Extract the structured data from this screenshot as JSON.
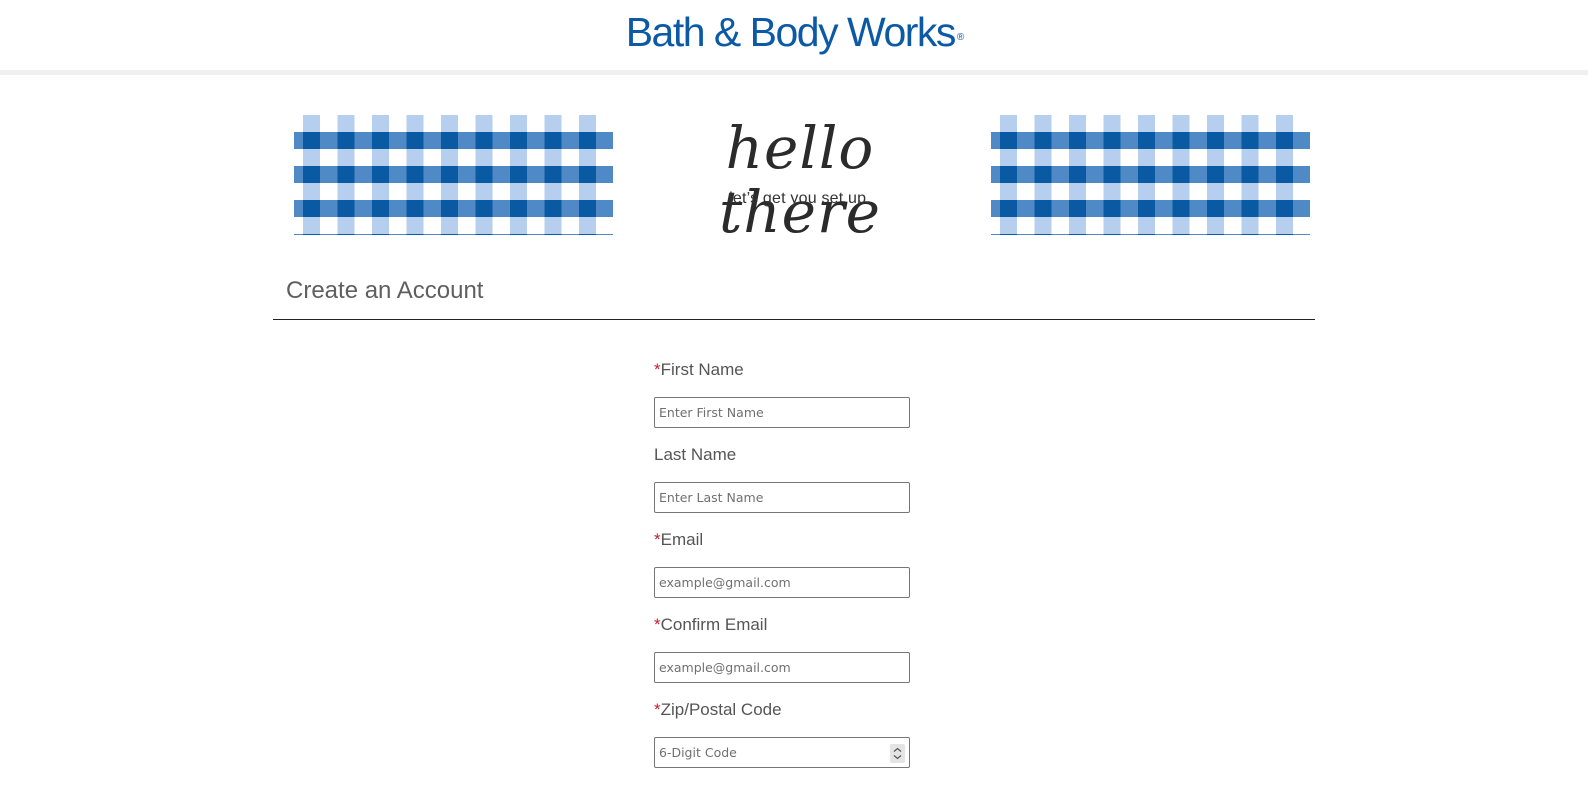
{
  "header": {
    "brand": "Bath & Body Works",
    "registered_mark": "®"
  },
  "banner": {
    "headline": "hello there",
    "subline": "let’s get you set up.",
    "colors": {
      "dark": "#0a5aa3",
      "medium": "#4f8ac6",
      "light": "#b7cfee",
      "white": "#ffffff"
    }
  },
  "section": {
    "title": "Create an Account"
  },
  "form": {
    "required_marker": "*",
    "fields": [
      {
        "label": "First Name",
        "required": true,
        "placeholder": "Enter First Name",
        "value": ""
      },
      {
        "label": "Last Name",
        "required": false,
        "placeholder": "Enter Last Name",
        "value": ""
      },
      {
        "label": "Email",
        "required": true,
        "placeholder": "example@gmail.com",
        "value": ""
      },
      {
        "label": "Confirm Email",
        "required": true,
        "placeholder": "example@gmail.com",
        "value": ""
      },
      {
        "label": "Zip/Postal Code",
        "required": true,
        "placeholder": "6-Digit Code",
        "value": ""
      }
    ]
  },
  "colors": {
    "brand_blue": "#0c5aa6",
    "required_red": "#c21f32",
    "label_gray": "#555555"
  },
  "icons": {
    "zip_spinner": "chevron-up-down-icon"
  }
}
